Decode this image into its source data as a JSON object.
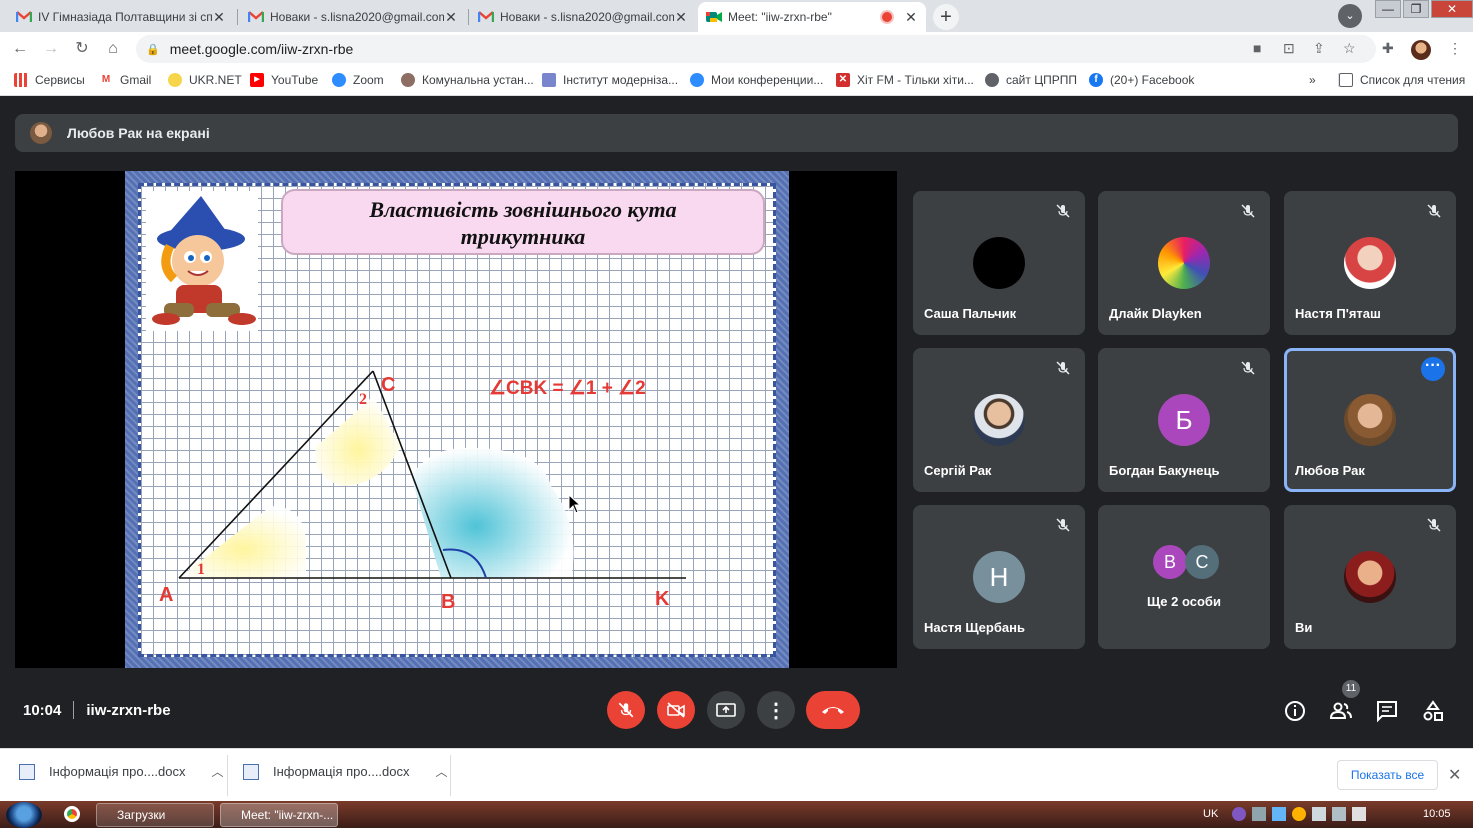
{
  "browser": {
    "tabs": [
      {
        "title": "IV Гімназіада Полтавщини зі сп",
        "icon": "gmail-icon"
      },
      {
        "title": "Новаки - s.lisna2020@gmail.com",
        "icon": "gmail-icon"
      },
      {
        "title": "Новаки - s.lisna2020@gmail.com",
        "icon": "gmail-icon"
      },
      {
        "title": "Meet: \"iiw-zrxn-rbe\"",
        "icon": "meet-icon",
        "active": true,
        "recording": true
      }
    ],
    "url": "meet.google.com/iiw-zrxn-rbe",
    "bookmarks": [
      {
        "label": "Сервисы",
        "icon": "apps-grid-icon"
      },
      {
        "label": "Gmail",
        "icon": "gmail-icon"
      },
      {
        "label": "UKR.NET",
        "icon": "ukrnet-icon"
      },
      {
        "label": "YouTube",
        "icon": "youtube-icon"
      },
      {
        "label": "Zoom",
        "icon": "zoom-icon"
      },
      {
        "label": "Комунальна устан...",
        "icon": "site-icon"
      },
      {
        "label": "Інститут модерніза...",
        "icon": "imzo-icon"
      },
      {
        "label": "Мои конференции...",
        "icon": "zoom-icon"
      },
      {
        "label": "Хіт FM - Тільки хіти...",
        "icon": "hitfm-icon"
      },
      {
        "label": "сайт ЦПРПП",
        "icon": "globe-icon"
      },
      {
        "label": "(20+) Facebook",
        "icon": "facebook-icon"
      }
    ],
    "bookmarks_overflow": "»",
    "reading_list": "Список для чтения"
  },
  "meet": {
    "presenter_banner": "Любов Рак на екрані",
    "slide": {
      "title_line1": "Властивість зовнішнього кута",
      "title_line2": "трикутника",
      "formula": "∠CBK = ∠1 + ∠2",
      "labels": {
        "A": "A",
        "B": "B",
        "C": "C",
        "K": "K",
        "angle1": "1",
        "angle2": "2"
      }
    },
    "participants": [
      {
        "name": "Саша Пальчик",
        "muted": true,
        "avatar": "black-circle"
      },
      {
        "name": "Длайк Dlayken",
        "muted": true,
        "avatar": "photo"
      },
      {
        "name": "Настя П'яташ",
        "muted": true,
        "avatar": "photo"
      },
      {
        "name": "Сергій Рак",
        "muted": true,
        "avatar": "photo"
      },
      {
        "name": "Богдан Бакунець",
        "muted": true,
        "avatar_letter": "Б",
        "avatar_color": "#ab47bc"
      },
      {
        "name": "Любов Рак",
        "muted": false,
        "avatar": "photo",
        "active": true
      },
      {
        "name": "Настя Щербань",
        "muted": true,
        "avatar_letter": "Н",
        "avatar_color": "#78909c"
      },
      {
        "name": "Ще 2 особи",
        "muted": false,
        "avatar_letters": [
          "В",
          "С"
        ],
        "avatar_colors": [
          "#ab47bc",
          "#546e7a"
        ]
      },
      {
        "name": "Ви",
        "muted": true,
        "avatar": "photo"
      }
    ],
    "time": "10:04",
    "meeting_code": "iiw-zrxn-rbe",
    "participants_count": "11"
  },
  "downloads": {
    "items": [
      {
        "name": "Інформація про....docx"
      },
      {
        "name": "Інформація про....docx"
      }
    ],
    "show_all": "Показать все"
  },
  "taskbar": {
    "apps": [
      {
        "label": "Загрузки"
      },
      {
        "label": "Meet: \"iiw-zrxn-..."
      }
    ],
    "lang": "UK",
    "clock": "10:05"
  }
}
